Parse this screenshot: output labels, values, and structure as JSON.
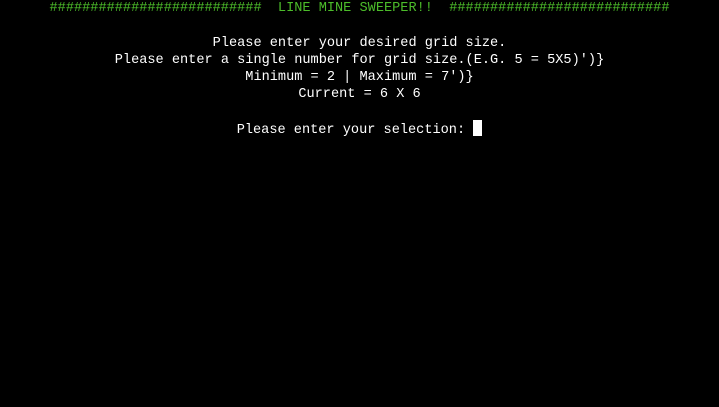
{
  "colors": {
    "background": "#000000",
    "banner_text": "#4cbc2a",
    "body_text": "#ffffff",
    "cursor": "#ffffff"
  },
  "banner": {
    "left_hashes": "##########################",
    "title": "  LINE MINE SWEEPER!!  ",
    "right_hashes": "###########################"
  },
  "prompt": {
    "line1": "Please enter your desired grid size.",
    "line2": "Please enter a single number for grid size.(E.G. 5 = 5X5)')}",
    "line3": "Minimum = 2 | Maximum = 7')}",
    "line4": "Current = 6 X 6",
    "input_label": "Please enter your selection: "
  },
  "input": {
    "value": ""
  }
}
